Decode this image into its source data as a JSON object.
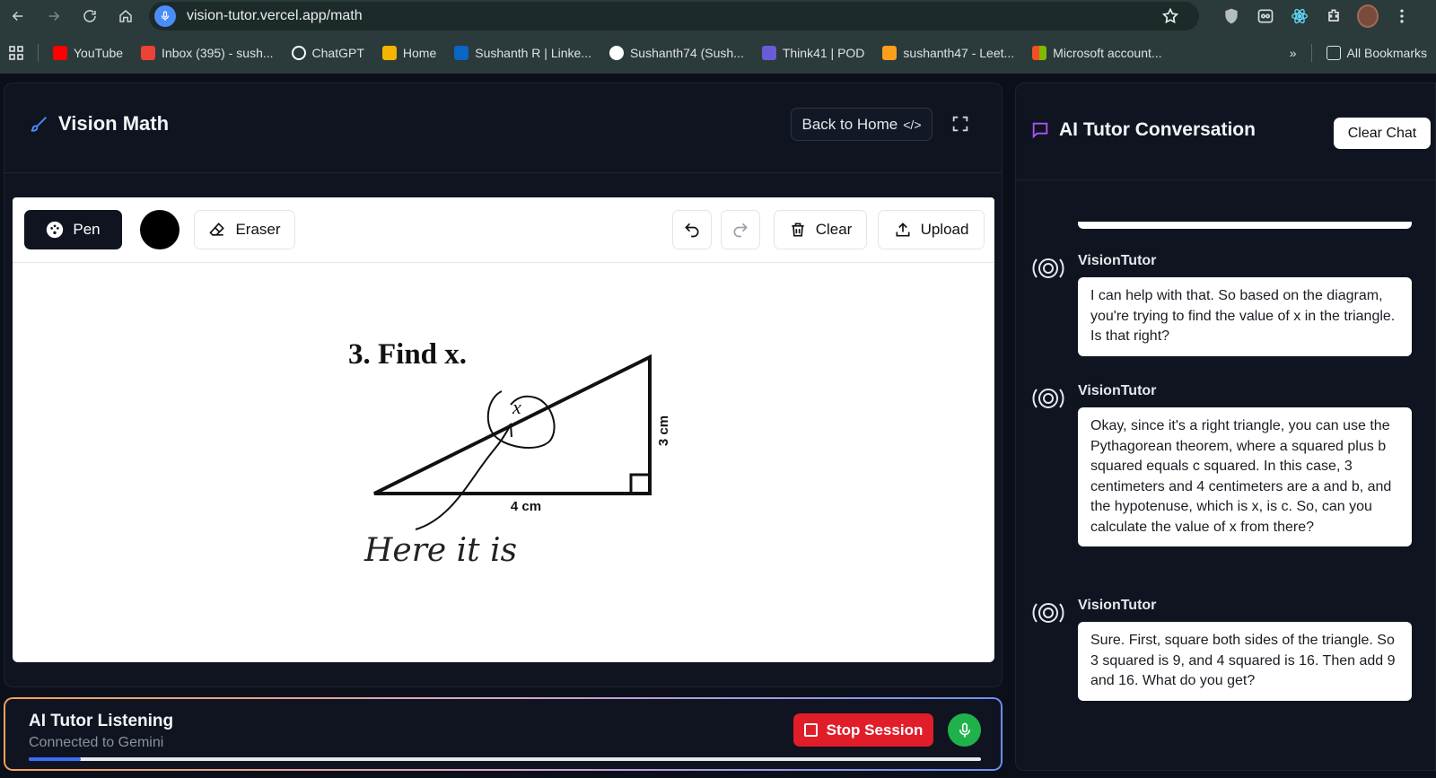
{
  "browser": {
    "url": "vision-tutor.vercel.app/math",
    "bookmarks": [
      {
        "label": "YouTube",
        "color": "#ff0000"
      },
      {
        "label": "Inbox (395) - sush...",
        "color": "#ea4335"
      },
      {
        "label": "ChatGPT",
        "color": "#ffffff"
      },
      {
        "label": "Home",
        "color": "#f4b400"
      },
      {
        "label": "Sushanth R | Linke...",
        "color": "#0a66c2"
      },
      {
        "label": "Sushanth74 (Sush...",
        "color": "#ffffff"
      },
      {
        "label": "Think41 | POD",
        "color": "#6b5bd6"
      },
      {
        "label": "sushanth47 - Leet...",
        "color": "#f89f1b"
      },
      {
        "label": "Microsoft account...",
        "color": "#f25022"
      }
    ],
    "all_bookmarks": "All Bookmarks"
  },
  "app": {
    "title": "Vision Math",
    "back_label": "Back to Home",
    "back_icon": "</>"
  },
  "toolbar": {
    "pen_label": "Pen",
    "pen_color": "#000000",
    "eraser_label": "Eraser",
    "clear_label": "Clear",
    "upload_label": "Upload"
  },
  "canvas": {
    "problem": "3. Find x.",
    "var": "x",
    "side_a": "3 cm",
    "side_b": "4 cm",
    "handwriting": "Here it is"
  },
  "listening": {
    "title": "AI Tutor Listening",
    "subtitle": "Connected to Gemini",
    "stop_label": "Stop Session",
    "progress": 0.055,
    "accent": "#e11d2a"
  },
  "chat": {
    "title": "AI Tutor Conversation",
    "clear_label": "Clear Chat",
    "messages": [
      {
        "author": "VisionTutor",
        "text": "I can help with that. So based on the diagram, you're trying to find the value of x in the triangle. Is that right?"
      },
      {
        "author": "VisionTutor",
        "text": "Okay, since it's a right triangle, you can use the Pythagorean theorem, where a squared plus b squared equals c squared. In this case, 3 centimeters and 4 centimeters are a and b, and the hypotenuse, which is x, is c. So, can you calculate the value of x from there?"
      },
      {
        "author": "VisionTutor",
        "text": "Sure. First, square both sides of the triangle. So 3 squared is 9, and 4 squared is 16. Then add 9 and 16. What do you get?"
      }
    ]
  }
}
